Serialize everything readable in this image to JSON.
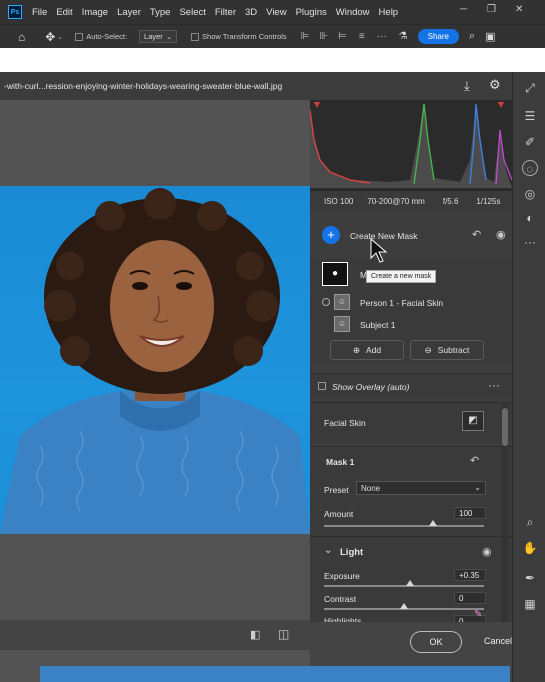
{
  "menu": [
    "File",
    "Edit",
    "Image",
    "Layer",
    "Type",
    "Select",
    "Filter",
    "3D",
    "View",
    "Plugins",
    "Window",
    "Help"
  ],
  "options": {
    "auto_select_label": "Auto-Select:",
    "layer_dropdown": "Layer",
    "show_transform_label": "Show Transform Controls",
    "share_label": "Share"
  },
  "dialog": {
    "filename": "-with-curl...ression-enjoying-winter-holidays-wearing-sweater-blue-wall.jpg",
    "exif": {
      "iso": "ISO 100",
      "lens": "70-200@70 mm",
      "aperture": "f/5.6",
      "shutter": "1/125s"
    },
    "create_mask_label": "Create New Mask",
    "tooltip": "Create a new mask",
    "mask_list": {
      "mask_item_label": "M",
      "person_label": "Person 1 - Facial Skin",
      "subject_label": "Subject 1"
    },
    "add_label": "Add",
    "subtract_label": "Subtract",
    "show_overlay_label": "Show Overlay (auto)",
    "facial_skin_label": "Facial Skin",
    "mask1_title": "Mask 1",
    "preset_label": "Preset",
    "preset_value": "None",
    "amount_label": "Amount",
    "amount_value": "100",
    "amount_fraction": 0.68,
    "light_title": "Light",
    "exposure_label": "Exposure",
    "exposure_value": "+0.35",
    "exposure_fraction": 0.54,
    "contrast_label": "Contrast",
    "contrast_value": "0",
    "contrast_fraction": 0.5,
    "highlights_label": "Highlights",
    "highlights_value": "0",
    "ok_label": "OK",
    "cancel_label": "Cancel"
  },
  "colors": {
    "accent": "#1473e6",
    "photo_bg": "#1e94dc",
    "sweater": "#3a82c4"
  }
}
